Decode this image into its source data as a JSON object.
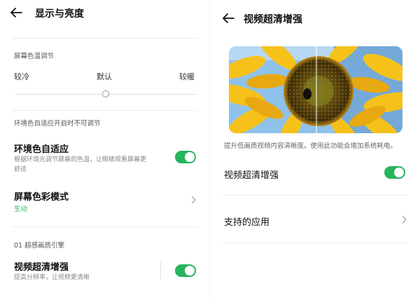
{
  "left": {
    "header": {
      "title": "显示与亮度"
    },
    "color_temp": {
      "section_title": "屏幕色温调节",
      "cold": "较冷",
      "default": "默认",
      "warm": "较暖",
      "level": 0.5,
      "note": "环境色自适应开启时不可调节"
    },
    "adaptive": {
      "title": "环境色自适应",
      "desc_line1": "根据环境光调节屏幕的色温，让眼睛观看屏幕更",
      "desc_line2": "舒适",
      "enabled": true
    },
    "color_mode": {
      "title": "屏幕色彩模式",
      "value": "生动"
    },
    "engine": {
      "section_title": "01 超感画质引擎"
    },
    "video": {
      "title": "视频超清增强",
      "desc": "提高分辨率，让视频更清晰",
      "enabled": true
    }
  },
  "right": {
    "header": {
      "title": "视频超清增强"
    },
    "note": "提升低画质视频内容清晰度。使用此功能会增加系统耗电。",
    "video_toggle": {
      "title": "视频超清增强",
      "enabled": true
    },
    "apps": {
      "title": "支持的应用"
    }
  },
  "colors": {
    "accent": "#27b45f"
  }
}
